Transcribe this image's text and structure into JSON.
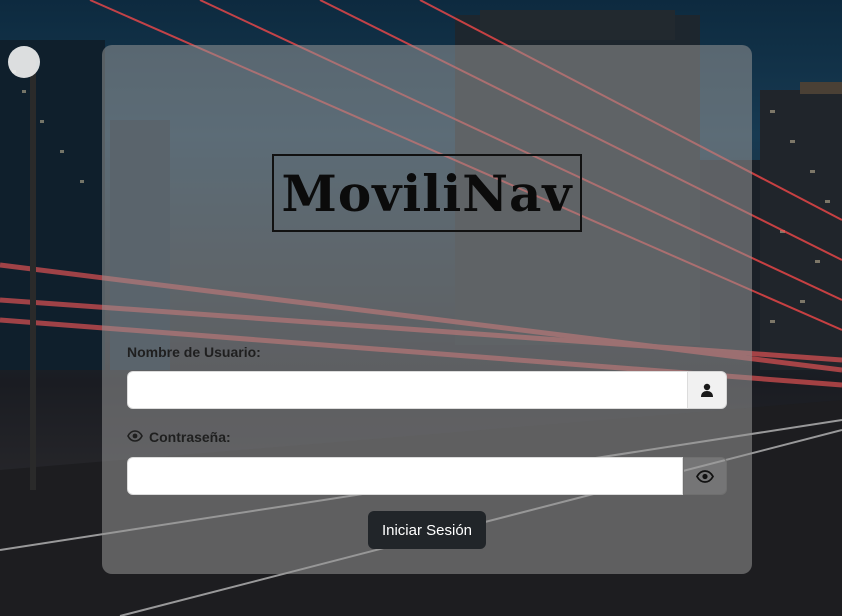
{
  "brand": {
    "logo_text": "MoviliNav"
  },
  "form": {
    "username_label": "Nombre de Usuario:",
    "username_value": "",
    "username_icon": "user-icon",
    "password_label": "Contraseña:",
    "password_label_icon": "eye-icon",
    "password_value": "",
    "password_toggle_icon": "eye-icon",
    "submit_label": "Iniciar Sesión"
  },
  "colors": {
    "submit_background": "#212529",
    "submit_text": "#ffffff",
    "card_overlay": "rgba(150,150,150,0.55)"
  }
}
